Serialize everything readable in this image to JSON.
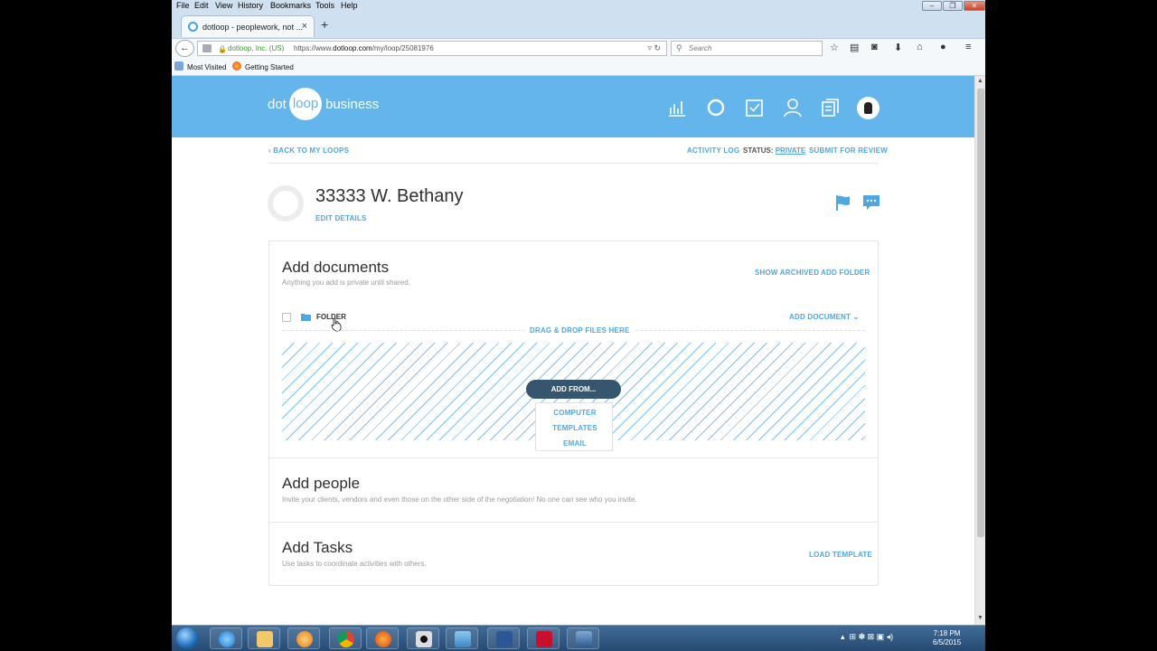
{
  "browser": {
    "menu": [
      "File",
      "Edit",
      "View",
      "History",
      "Bookmarks",
      "Tools",
      "Help"
    ],
    "tab_title": "dotloop - peoplework, not ...",
    "tab_close": "×",
    "new_tab": "+",
    "identity": "dotloop, Inc. (US)",
    "url_prefix": "https://www.",
    "url_host": "dotloop.com",
    "url_path": "/my/loop/25081976",
    "search_placeholder": "Search",
    "bookmarks": [
      "Most Visited",
      "Getting Started"
    ]
  },
  "logo": {
    "dot": "dot",
    "loop": "loop",
    "business": "business"
  },
  "nav": {
    "back": "BACK TO MY LOOPS",
    "activity": "ACTIVITY LOG",
    "status_label": "STATUS:",
    "status_value": "PRIVATE",
    "submit": "SUBMIT FOR REVIEW"
  },
  "loop": {
    "title": "33333 W. Bethany",
    "edit": "EDIT DETAILS"
  },
  "documents": {
    "heading": "Add documents",
    "subtitle": "Anything you add is private until shared.",
    "show_archived": "SHOW ARCHIVED",
    "add_folder": "ADD FOLDER",
    "folder_label": "FOLDER",
    "add_document": "ADD DOCUMENT",
    "drop_label": "DRAG & DROP FILES HERE",
    "add_from": "ADD FROM...",
    "menu": [
      "COMPUTER",
      "TEMPLATES",
      "EMAIL"
    ]
  },
  "people": {
    "heading": "Add people",
    "subtitle": "Invite your clients, vendors and even those on the other side of the negotiation! No one can see who you invite."
  },
  "tasks": {
    "heading": "Add Tasks",
    "subtitle": "Use tasks to coordinate activities with others.",
    "load": "LOAD TEMPLATE"
  },
  "clock": {
    "time": "7:18 PM",
    "date": "6/5/2015"
  },
  "colors": {
    "header": "#64b5ec",
    "accent": "#4fa6e0",
    "button": "#36556e"
  }
}
